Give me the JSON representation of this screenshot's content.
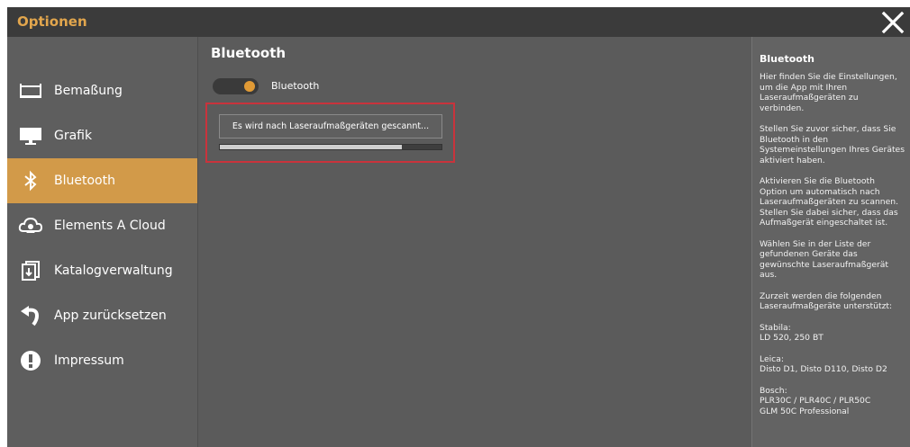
{
  "window": {
    "title": "Optionen"
  },
  "sidebar": {
    "items": [
      {
        "label": "Bemaßung",
        "icon": "dimension-icon",
        "active": false
      },
      {
        "label": "Grafik",
        "icon": "monitor-icon",
        "active": false
      },
      {
        "label": "Bluetooth",
        "icon": "bluetooth-icon",
        "active": true
      },
      {
        "label": "Elements A Cloud",
        "icon": "cloud-icon",
        "active": false
      },
      {
        "label": "Katalogverwaltung",
        "icon": "catalog-icon",
        "active": false
      },
      {
        "label": "App zurücksetzen",
        "icon": "reset-icon",
        "active": false
      },
      {
        "label": "Impressum",
        "icon": "info-icon",
        "active": false
      }
    ]
  },
  "main": {
    "title": "Bluetooth",
    "toggle": {
      "label": "Bluetooth",
      "on": true
    },
    "scan": {
      "status": "Es wird nach Laseraufmaßgeräten gescannt...",
      "progress": 0.82
    }
  },
  "help": {
    "title": "Bluetooth",
    "paragraphs": [
      "Hier finden Sie die Einstellungen, um die App mit Ihren Laseraufmaßgeräten zu verbinden.",
      "Stellen Sie zuvor sicher, dass Sie Bluetooth in den Systemeinstellungen Ihres Gerätes aktiviert haben.",
      "Aktivieren Sie die Bluetooth Option um automatisch nach Laseraufmaßgeräten zu scannen. Stellen Sie dabei sicher, dass das Aufmaßgerät eingeschaltet ist.",
      "Wählen Sie in der Liste der gefundenen Geräte das gewünschte Laseraufmaßgerät aus.",
      "Zurzeit werden die folgenden Laseraufmaßgeräte unterstützt:",
      "Stabila:\nLD 520, 250 BT",
      "Leica:\nDisto D1, Disto D110, Disto D2",
      "Bosch:\nPLR30C / PLR40C / PLR50C\nGLM 50C Professional"
    ]
  },
  "colors": {
    "accent": "#d29a49",
    "title": "#e2a64d",
    "highlight": "#c9333c"
  }
}
